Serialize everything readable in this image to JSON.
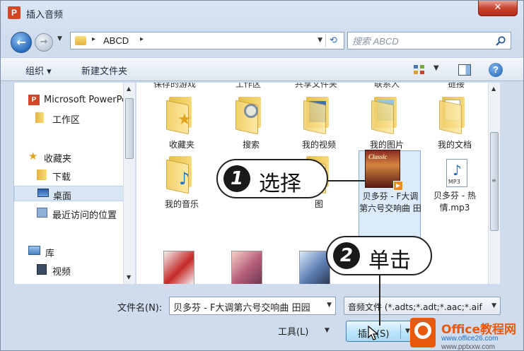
{
  "window": {
    "title": "插入音频",
    "app_icon": "P",
    "close_glyph": "✕"
  },
  "address_bar": {
    "path": [
      "ABCD"
    ],
    "separator": "▸"
  },
  "search": {
    "placeholder": "搜索 ABCD"
  },
  "toolbar": {
    "organize_label": "组织 ▾",
    "new_folder_label": "新建文件夹"
  },
  "navigation": {
    "items": [
      {
        "label": "Microsoft PowerPoint",
        "icon": "powerpoint-icon"
      },
      {
        "label": "工作区",
        "icon": "folder-icon"
      },
      {
        "label": "收藏夹",
        "icon": "star-icon"
      },
      {
        "label": "下载",
        "icon": "download-folder-icon"
      },
      {
        "label": "桌面",
        "icon": "desktop-icon"
      },
      {
        "label": "最近访问的位置",
        "icon": "recent-places-icon"
      },
      {
        "label": "库",
        "icon": "library-icon"
      },
      {
        "label": "视频",
        "icon": "video-library-icon"
      }
    ],
    "selected": "桌面"
  },
  "files": {
    "cut_labels": [
      "保存的游戏",
      "工作区",
      "共享文件夹",
      "联系人",
      "链接"
    ],
    "items": [
      {
        "name": "收藏夹",
        "type": "folder"
      },
      {
        "name": "搜索",
        "type": "folder"
      },
      {
        "name": "我的视频",
        "type": "folder"
      },
      {
        "name": "我的图片",
        "type": "folder"
      },
      {
        "name": "我的文档",
        "type": "folder"
      },
      {
        "name": "我的音乐",
        "type": "folder"
      },
      {
        "name": "图",
        "type": "folder"
      },
      {
        "name": "贝多芬 - F大调第六号交响曲 田",
        "type": "audio",
        "album_text": "Classic"
      },
      {
        "name": "贝多芬 - 热情.mp3",
        "type": "mp3",
        "badge": "MP3"
      }
    ]
  },
  "bottom": {
    "filename_label": "文件名(N):",
    "filename_value": "贝多芬 - F大调第六号交响曲 田园",
    "filter_value": "音频文件 (*.adts;*.adt;*.aac;*.aif",
    "tools_label": "工具(L)",
    "insert_label": "插入(S)"
  },
  "callouts": [
    {
      "number": "1",
      "text": "选择"
    },
    {
      "number": "2",
      "text": "单击"
    }
  ],
  "watermark": {
    "brand": "Office教程网",
    "url1": "www.office26.com",
    "url2": "www.pptxxw.com"
  },
  "colors": {
    "accent": "#3c7fb1",
    "selection": "#dcebfc",
    "close": "#c7442f",
    "watermark": "#e8590c"
  }
}
